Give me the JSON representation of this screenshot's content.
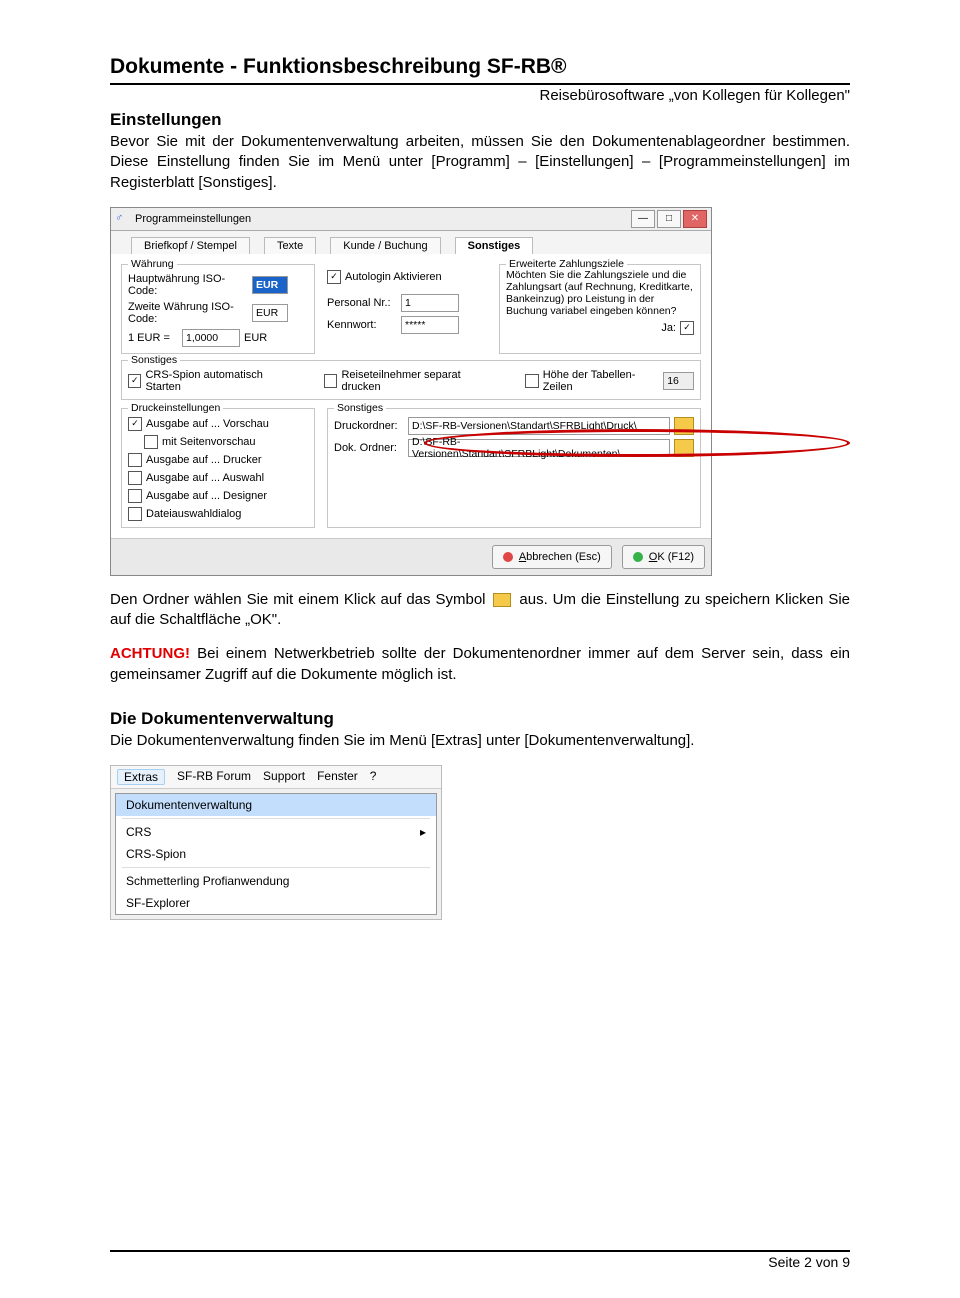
{
  "doc": {
    "title": "Dokumente - Funktionsbeschreibung SF-RB®",
    "subtitle": "Reisebürosoftware „von Kollegen für Kollegen\"",
    "h_einstellungen": "Einstellungen",
    "p_einst": "Bevor Sie mit der Dokumentenverwaltung arbeiten, müssen Sie den Dokumentenablageordner bestimmen. Diese Einstellung finden Sie im Menü unter [Programm] – [Einstellungen] – [Programmeinstellungen] im Registerblatt [Sonstiges].",
    "p_ordner_1": "Den Ordner wählen Sie mit einem Klick auf das Symbol ",
    "p_ordner_2": " aus. Um die Einstellung zu speichern Klicken Sie auf die Schaltfläche „OK\".",
    "achtung_label": "ACHTUNG!",
    "p_achtung": " Bei einem Netwerkbetrieb sollte der Dokumentenordner immer auf dem Server sein, dass ein gemeinsamer Zugriff auf die Dokumente möglich ist.",
    "h_verwaltung": "Die Dokumentenverwaltung",
    "p_verwaltung": "Die Dokumentenverwaltung finden Sie im Menü [Extras] unter [Dokumentenverwaltung].",
    "page_counter": "Seite 2 von 9"
  },
  "settings_dialog": {
    "title": "Programmeinstellungen",
    "tabs": {
      "t1": "Briefkopf / Stempel",
      "t2": "Texte",
      "t3": "Kunde / Buchung",
      "t4": "Sonstiges"
    },
    "grp_waehrung": {
      "title": "Währung",
      "l1": "Hauptwährung ISO-Code:",
      "v1": "EUR",
      "l2": "Zweite Währung ISO-Code:",
      "v2": "EUR",
      "l3": "1 EUR =",
      "v3": "1,0000",
      "v3b": "EUR"
    },
    "col2": {
      "autologin_label": "Autologin Aktivieren",
      "personal_label": "Personal Nr.:",
      "personal_val": "1",
      "kennwort_label": "Kennwort:",
      "kennwort_val": "*****"
    },
    "grp_ext": {
      "title": "Erweiterte Zahlungsziele",
      "text": "Möchten Sie die Zahlungsziele und die Zahlungsart (auf Rechnung, Kreditkarte, Bankeinzug) pro Leistung in der Buchung variabel eingeben können?",
      "ja": "Ja:"
    },
    "grp_sonst1": {
      "title": "Sonstiges",
      "l1": "CRS-Spion automatisch Starten",
      "l2": "Reiseteilnehmer separat drucken",
      "l3": "Höhe der Tabellen-Zeilen",
      "v3": "16"
    },
    "grp_druck": {
      "title": "Druckeinstellungen",
      "o1": "Ausgabe auf ... Vorschau",
      "o1b": "mit Seitenvorschau",
      "o2": "Ausgabe auf ... Drucker",
      "o3": "Ausgabe auf ... Auswahl",
      "o4": "Ausgabe auf ... Designer",
      "o5": "Dateiauswahldialog"
    },
    "grp_folders": {
      "title": "Sonstiges",
      "l1": "Druckordner:",
      "v1": "D:\\SF-RB-Versionen\\Standart\\SFRBLight\\Druck\\",
      "l2": "Dok. Ordner:",
      "v2": "D:\\SF-RB-Versionen\\Standart\\SFRBLight\\Dokumenten\\"
    },
    "btn_cancel_1": "A",
    "btn_cancel_2": "bbrechen (Esc)",
    "btn_ok_1": "O",
    "btn_ok_2": "K (F12)"
  },
  "menu": {
    "bar": {
      "m1": "Extras",
      "m2": "SF-RB Forum",
      "m3": "Support",
      "m4": "Fenster",
      "m5": "?"
    },
    "items": {
      "i1": "Dokumentenverwaltung",
      "i2": "CRS",
      "i3": "CRS-Spion",
      "i4": "Schmetterling Profianwendung",
      "i5": "SF-Explorer"
    },
    "arrow": "▸"
  }
}
